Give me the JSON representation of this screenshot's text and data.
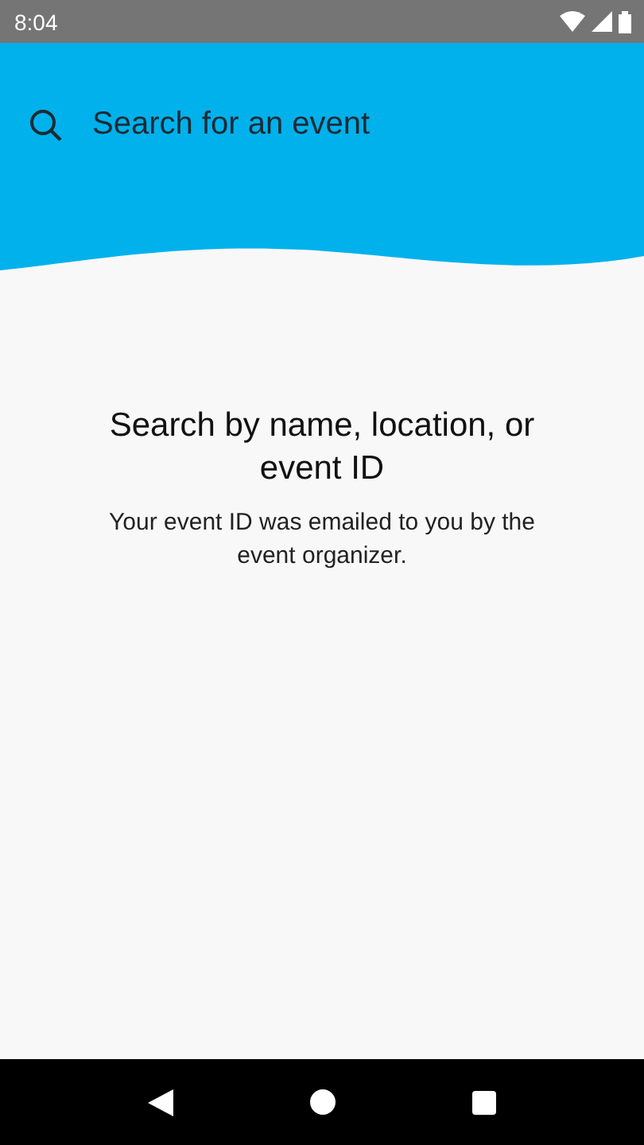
{
  "status_bar": {
    "time": "8:04"
  },
  "search": {
    "placeholder": "Search for an event"
  },
  "empty_state": {
    "title": "Search by name, location, or event ID",
    "message": "Your event ID was emailed to you by the event organizer."
  }
}
